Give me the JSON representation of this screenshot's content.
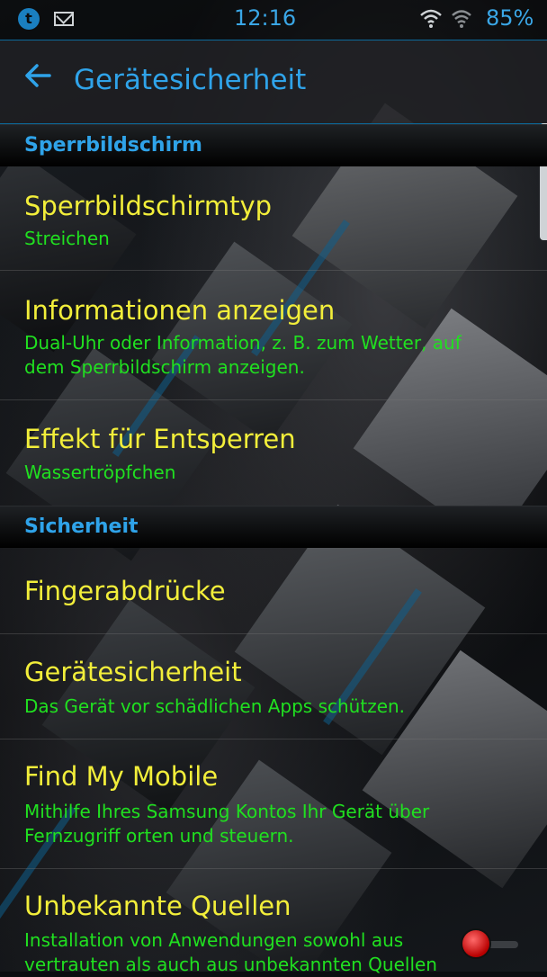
{
  "status_bar": {
    "time": "12:16",
    "battery": "85%",
    "notifications": [
      "tumblr-icon",
      "gmail-icon"
    ],
    "status_icons": [
      "wifi-icon",
      "signal-icon"
    ]
  },
  "header": {
    "back_icon": "arrow-back-icon",
    "title": "Gerätesicherheit"
  },
  "sections": [
    {
      "label": "Sperrbildschirm",
      "items": [
        {
          "title": "Sperrbildschirmtyp",
          "subtitle": "Streichen"
        },
        {
          "title": "Informationen anzeigen",
          "subtitle_line1": "Dual-Uhr oder Information, z. B. zum Wetter, auf",
          "subtitle_line2": "dem Sperrbildschirm anzeigen."
        },
        {
          "title": "Effekt für Entsperren",
          "subtitle": "Wassertröpfchen"
        }
      ]
    },
    {
      "label": "Sicherheit",
      "items": [
        {
          "title": "Fingerabdrücke"
        },
        {
          "title": "Gerätesicherheit",
          "subtitle": "Das Gerät vor schädlichen Apps schützen."
        },
        {
          "title": "Find My Mobile",
          "subtitle_line1": "Mithilfe Ihres Samsung Kontos Ihr Gerät über",
          "subtitle_line2": "Fernzugriff orten und steuern."
        },
        {
          "title": "Unbekannte Quellen",
          "subtitle_line1": "Installation von Anwendungen sowohl aus",
          "subtitle_line2": "vertrauten als auch aus unbekannten Quellen",
          "toggle_on": false
        }
      ]
    }
  ],
  "colors": {
    "accent": "#2fa3e9",
    "title_text": "#f2ee3a",
    "subtitle_text": "#20e020",
    "toggle_off": "#cc0000"
  }
}
